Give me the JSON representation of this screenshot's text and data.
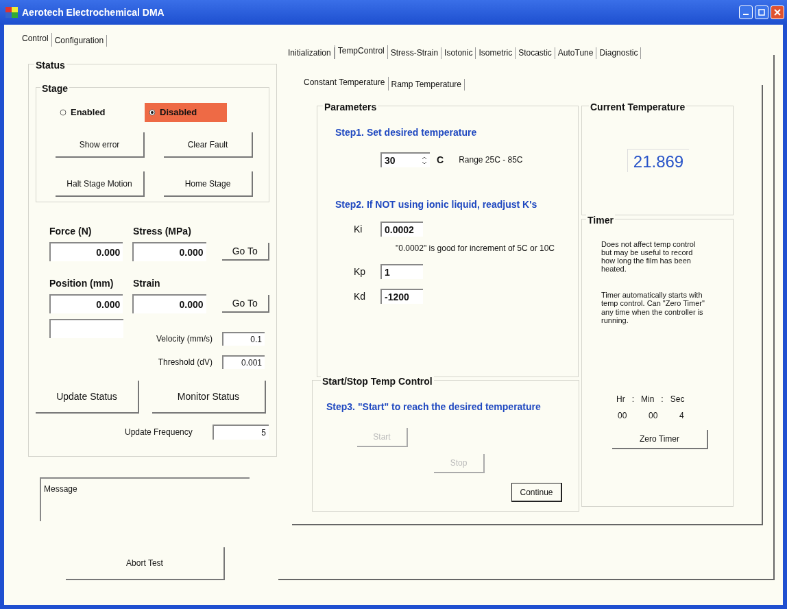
{
  "window": {
    "title": "Aerotech Electrochemical DMA"
  },
  "left_tabs": [
    {
      "label": "Control",
      "selected": true
    },
    {
      "label": "Configuration",
      "selected": false
    }
  ],
  "status": {
    "title": "Status",
    "stage": {
      "title": "Stage",
      "options": [
        {
          "label": "Enabled",
          "selected": false
        },
        {
          "label": "Disabled",
          "selected": true
        }
      ],
      "buttons": [
        "Show error",
        "Clear Fault",
        "Halt Stage Motion",
        "Home Stage"
      ]
    },
    "rows": [
      {
        "fields": [
          {
            "label": "Force (N)",
            "value": "0.000"
          },
          {
            "label": "Stress (MPa)",
            "value": "0.000"
          }
        ],
        "button": "Go To"
      },
      {
        "fields": [
          {
            "label": "Position (mm)",
            "value": "0.000"
          },
          {
            "label": "Strain",
            "value": "0.000"
          }
        ],
        "button": "Go To"
      }
    ],
    "settings": [
      {
        "label": "Velocity (mm/s)",
        "value": "0.1"
      },
      {
        "label": "Threshold (dV)",
        "value": "0.001"
      }
    ],
    "buttons": [
      "Update Status",
      "Monitor Status"
    ],
    "frequency": {
      "label": "Update Frequency",
      "value": "5"
    }
  },
  "message": {
    "value": "Message"
  },
  "abort_button": "Abort Test",
  "tabs": [
    {
      "label": "Initialization",
      "selected": false
    },
    {
      "label": "TempControl",
      "selected": true
    },
    {
      "label": "Stress-Strain",
      "selected": false
    },
    {
      "label": "Isotonic",
      "selected": false
    },
    {
      "label": "Isometric",
      "selected": false
    },
    {
      "label": "Stocastic",
      "selected": false
    },
    {
      "label": "AutoTune",
      "selected": false
    },
    {
      "label": "Diagnostic",
      "selected": false
    }
  ],
  "sub_tabs": [
    {
      "label": "Constant Temperature",
      "selected": true
    },
    {
      "label": "Ramp Temperature",
      "selected": false
    }
  ],
  "parameters": {
    "title": "Parameters",
    "step1": "Step1. Set desired temperature",
    "setpoint": {
      "value": "30",
      "unit": "C",
      "range": "Range 25C - 85C"
    },
    "step2": "Step2.  If NOT using ionic liquid, readjust K's",
    "gains": [
      {
        "label": "Ki",
        "value": "0.0002",
        "note": "\"0.0002\" is good for increment of 5C or 10C"
      },
      {
        "label": "Kp",
        "value": "1"
      },
      {
        "label": "Kd",
        "value": "-1200"
      }
    ]
  },
  "current_temperature": {
    "title": "Current Temperature",
    "value": "21.869"
  },
  "timer": {
    "title": "Timer",
    "notes": [
      "Does not affect temp control but may be useful to record how long the film has been heated.",
      "Timer automatically starts with temp control.  Can \"Zero Timer\" any time when the controller is running."
    ],
    "headers": [
      "Hr",
      ":",
      "Min",
      ":",
      "Sec"
    ],
    "values": [
      "00",
      "00",
      "4"
    ],
    "button": "Zero Timer"
  },
  "start_stop": {
    "title": "Start/Stop Temp Control",
    "step3": "Step3.  \"Start\" to reach the desired temperature",
    "buttons": [
      {
        "label": "Start",
        "disabled": true,
        "default": false
      },
      {
        "label": "Stop",
        "disabled": true,
        "default": false
      },
      {
        "label": "Continue",
        "disabled": false,
        "default": true
      }
    ]
  }
}
